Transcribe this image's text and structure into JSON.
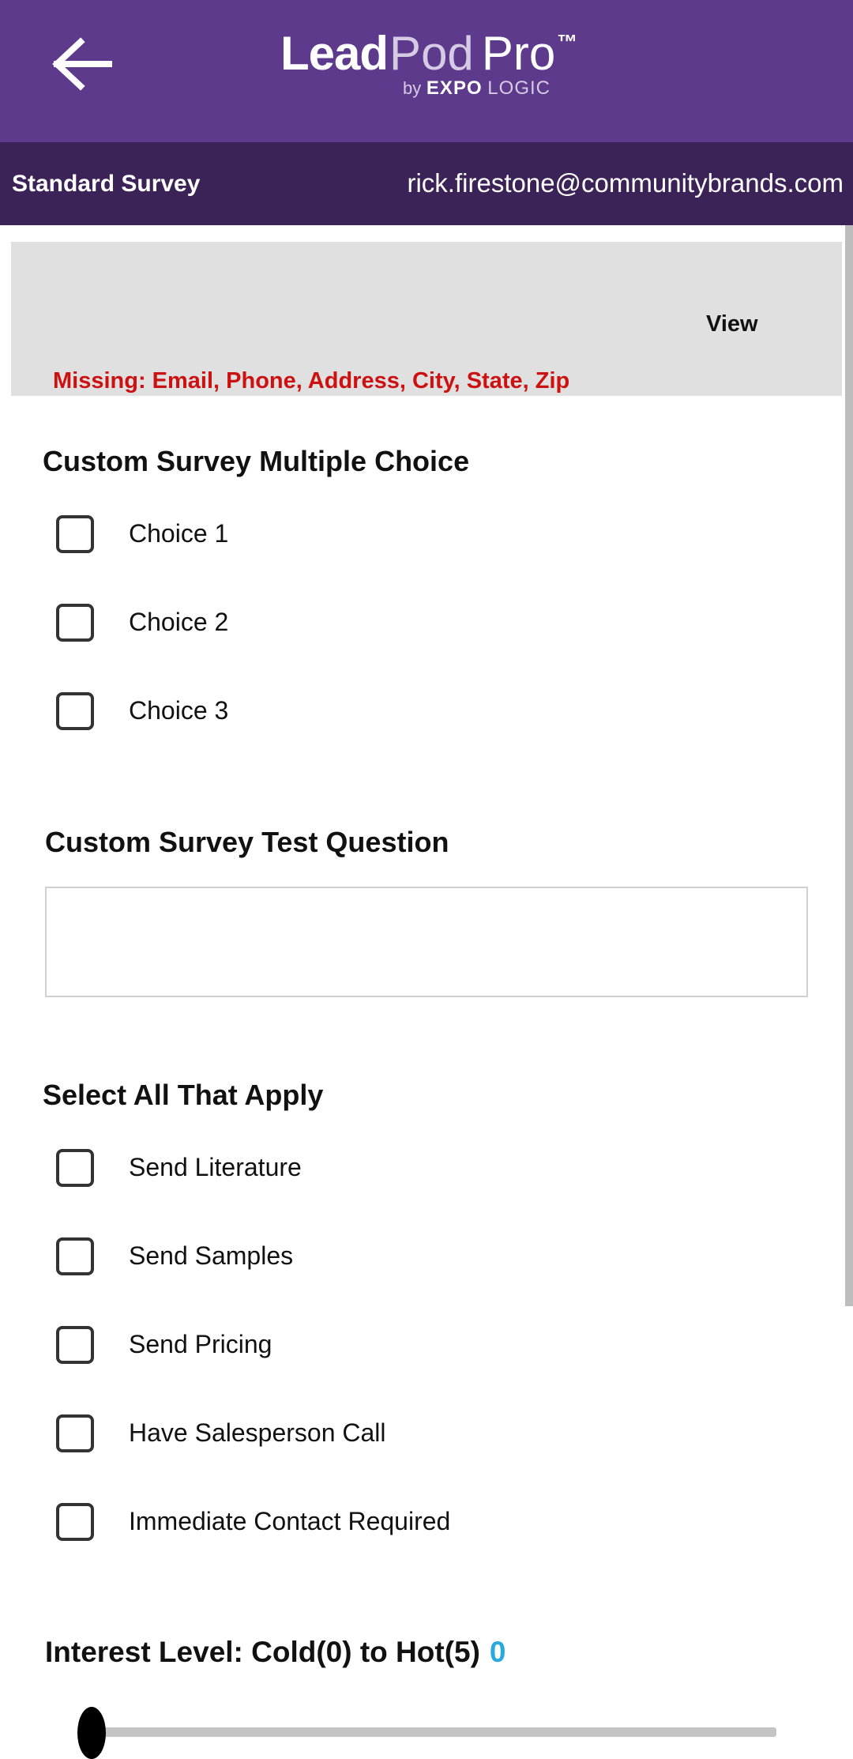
{
  "header": {
    "logo": {
      "lead": "Lead",
      "pod": "Pod",
      "pro": "Pro",
      "tm": "™",
      "by": "by",
      "expo": "EXPO",
      "logic": "LOGIC"
    },
    "back_icon": "arrow-left-icon",
    "color": "#5d3a8b"
  },
  "subheader": {
    "survey_name": "Standard Survey",
    "user_email": "rick.firestone@communitybrands.com",
    "color": "#3b2357"
  },
  "contact": {
    "view_label": "View",
    "missing_text": "Missing: Email, Phone, Address, City, State, Zip",
    "missing_color": "#cc1111"
  },
  "questions": {
    "multiple_choice": {
      "title": "Custom Survey Multiple Choice",
      "options": [
        "Choice 1",
        "Choice 2",
        "Choice 3"
      ]
    },
    "test_question": {
      "title": "Custom Survey Test Question",
      "value": ""
    },
    "select_all": {
      "title": "Select All That Apply",
      "options": [
        "Send Literature",
        "Send Samples",
        "Send Pricing",
        "Have Salesperson Call",
        "Immediate Contact Required"
      ]
    },
    "interest": {
      "label": "Interest Level: Cold(0) to Hot(5)",
      "value": "0",
      "min": 0,
      "max": 5,
      "value_color": "#29a9e0"
    }
  }
}
